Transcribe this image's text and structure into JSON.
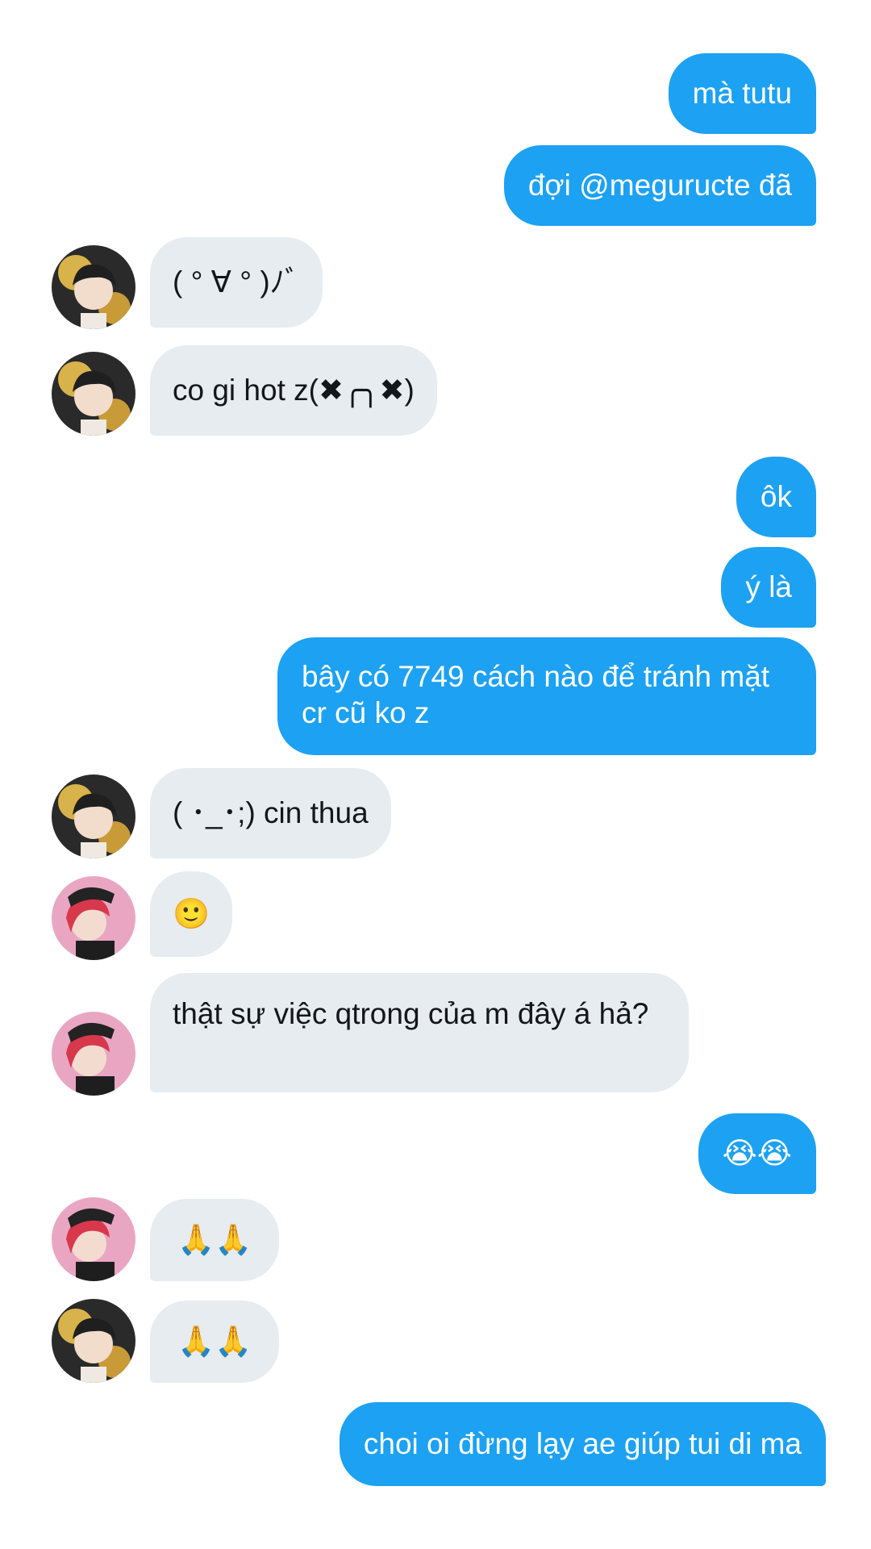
{
  "conversation": {
    "messages": [
      {
        "direction": "outgoing",
        "text": "mà tutu"
      },
      {
        "direction": "outgoing",
        "text": "đợi @meguructe đã"
      },
      {
        "direction": "incoming",
        "avatar": "avatar-dark-hair-user",
        "text": "( ° ∀ ° )ﾉﾞ"
      },
      {
        "direction": "incoming",
        "avatar": "avatar-dark-hair-user",
        "text": "co gi hot z(✖╭╮✖)"
      },
      {
        "direction": "outgoing",
        "text": "ôk"
      },
      {
        "direction": "outgoing",
        "text": "ý là"
      },
      {
        "direction": "outgoing",
        "text": "bây có 7749 cách nào để tránh mặt cr cũ ko z"
      },
      {
        "direction": "incoming",
        "avatar": "avatar-dark-hair-user",
        "text": "( ･_･;) cin thua"
      },
      {
        "direction": "incoming",
        "avatar": "avatar-red-hair-user",
        "text": "🙂"
      },
      {
        "direction": "incoming",
        "avatar": "avatar-red-hair-user",
        "text": "thật sự việc qtrong của m đây á hả?"
      },
      {
        "direction": "outgoing",
        "text": "😭😭"
      },
      {
        "direction": "incoming",
        "avatar": "avatar-red-hair-user",
        "text": "🙏🙏"
      },
      {
        "direction": "incoming",
        "avatar": "avatar-dark-hair-user",
        "text": "🙏🙏"
      },
      {
        "direction": "outgoing",
        "text": "choi oi đừng lạy ae giúp tui di ma"
      }
    ]
  },
  "colors": {
    "outgoing_bubble": "#1DA1F2",
    "incoming_bubble": "#E6ECF0",
    "incoming_text": "#14171A",
    "background": "#FFFFFF"
  }
}
